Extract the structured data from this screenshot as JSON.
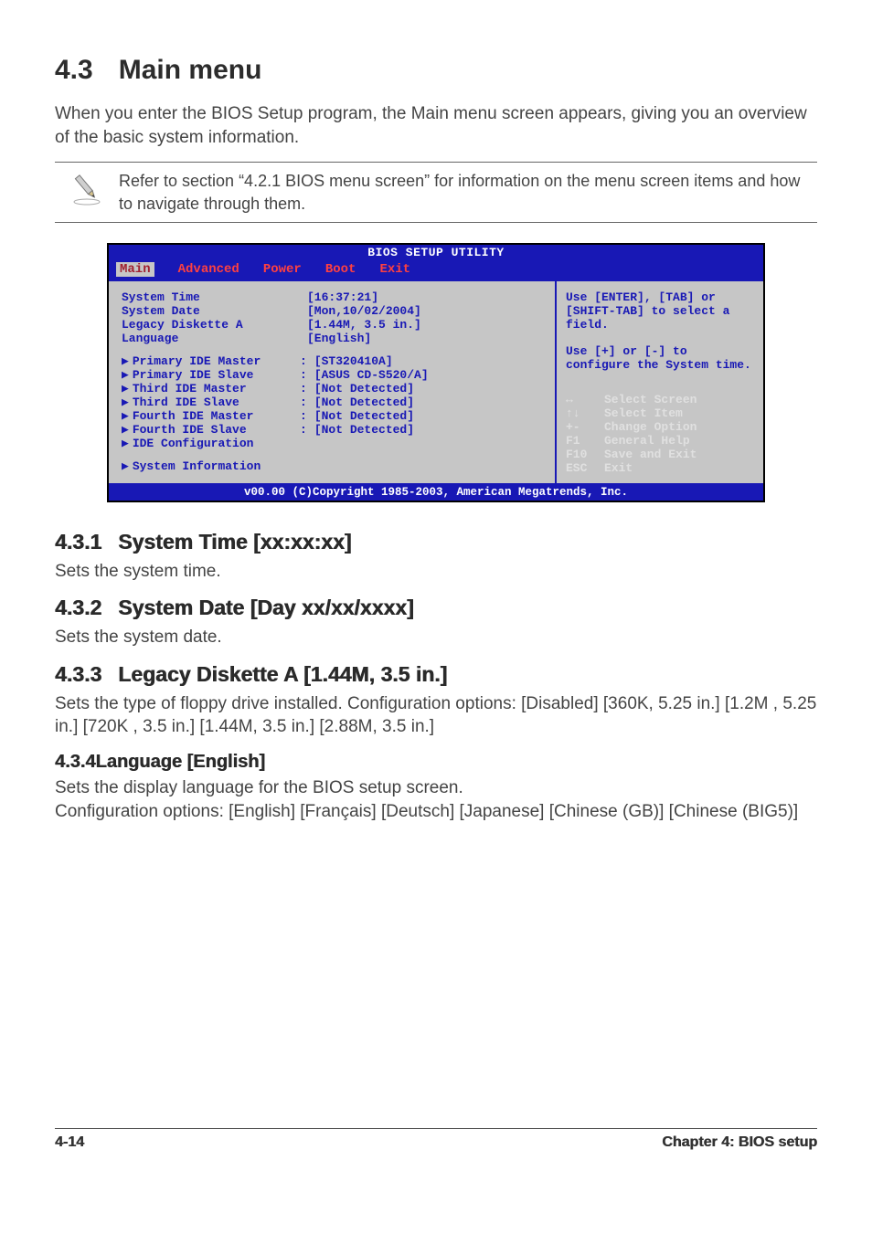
{
  "heading": {
    "num": "4.3",
    "title": "Main menu"
  },
  "intro": "When you enter the BIOS Setup program, the Main menu screen appears, giving you an overview of the basic system information.",
  "note": "Refer to section “4.2.1  BIOS menu screen” for information on the menu screen items and how to navigate through them.",
  "bios": {
    "title": "BIOS SETUP UTILITY",
    "tabs": [
      "Main",
      "Advanced",
      "Power",
      "Boot",
      "Exit"
    ],
    "selected_tab": "Main",
    "fields_top": [
      {
        "label": "System Time",
        "value": "[16:37:21]"
      },
      {
        "label": "System Date",
        "value": "[Mon,10/02/2004]"
      },
      {
        "label": "Legacy Diskette A",
        "value": "[1.44M, 3.5 in.]"
      },
      {
        "label": "Language",
        "value": "[English]"
      }
    ],
    "fields_ide": [
      {
        "label": "Primary IDE Master",
        "value": "[ST320410A]"
      },
      {
        "label": "Primary IDE Slave",
        "value": "[ASUS CD-S520/A]"
      },
      {
        "label": "Third IDE Master",
        "value": "[Not Detected]"
      },
      {
        "label": "Third IDE Slave",
        "value": "[Not Detected]"
      },
      {
        "label": "Fourth IDE Master",
        "value": "[Not Detected]"
      },
      {
        "label": "Fourth IDE Slave",
        "value": "[Not Detected]"
      },
      {
        "label": "IDE Configuration",
        "value": ""
      }
    ],
    "sysinfo_label": "System Information",
    "help1": "Use [ENTER], [TAB] or [SHIFT-TAB] to select a field.",
    "help2": "Use [+] or [-] to configure the System time.",
    "keys": [
      {
        "key": "↔",
        "action": "Select Screen"
      },
      {
        "key": "↑↓",
        "action": "Select Item"
      },
      {
        "key": "+-",
        "action": "Change Option"
      },
      {
        "key": "F1",
        "action": "General Help"
      },
      {
        "key": "F10",
        "action": "Save and Exit"
      },
      {
        "key": "ESC",
        "action": "Exit"
      }
    ],
    "footer": "v00.00 (C)Copyright 1985-2003, American Megatrends, Inc."
  },
  "sections": {
    "s1": {
      "num": "4.3.1",
      "title": "System Time [xx:xx:xx]",
      "body": "Sets the system time."
    },
    "s2": {
      "num": "4.3.2",
      "title": "System Date [Day xx/xx/xxxx]",
      "body": "Sets the system date."
    },
    "s3": {
      "num": "4.3.3",
      "title": "Legacy Diskette A [1.44M, 3.5 in.]",
      "body": "Sets the type of floppy drive installed. Configuration options: [Disabled] [360K, 5.25 in.] [1.2M , 5.25 in.] [720K , 3.5 in.] [1.44M, 3.5 in.] [2.88M, 3.5 in.]"
    },
    "s4": {
      "num": "4.3.4",
      "title": "Language [English]",
      "body": "Sets the display language for the BIOS setup screen.\nConfiguration options: [English] [Français] [Deutsch] [Japanese] [Chinese (GB)] [Chinese (BIG5)]"
    }
  },
  "footer": {
    "left": "4-14",
    "right": "Chapter 4: BIOS setup"
  }
}
